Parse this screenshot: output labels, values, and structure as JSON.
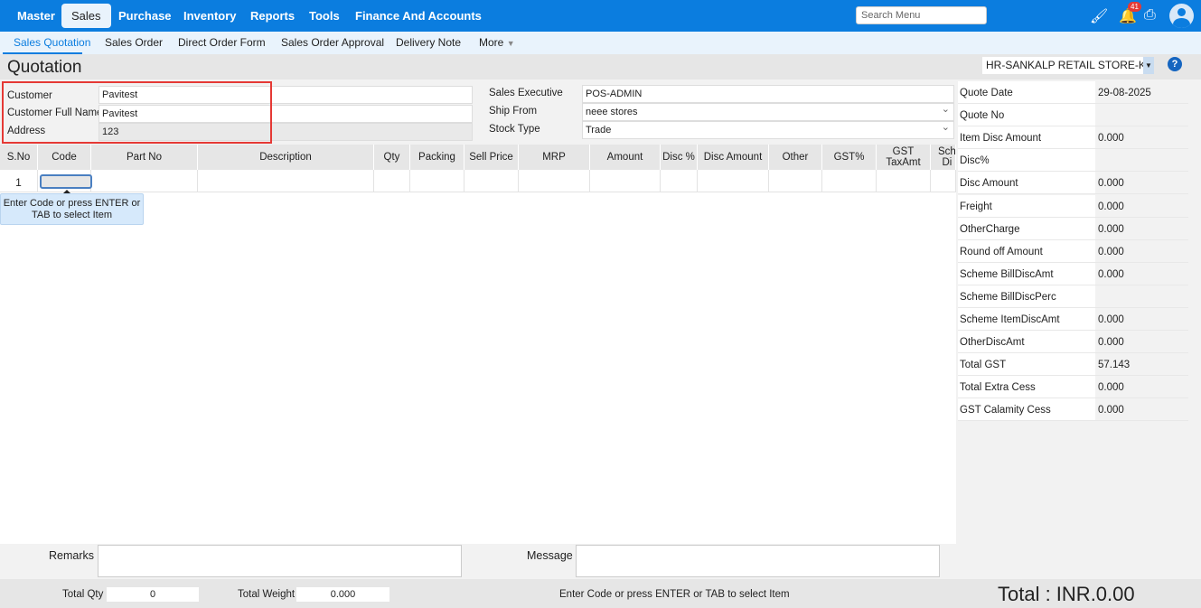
{
  "nav": {
    "items": [
      "Master",
      "Sales",
      "Purchase",
      "Inventory",
      "Reports",
      "Tools",
      "Finance And Accounts"
    ],
    "active": "Sales",
    "search_placeholder": "Search Menu",
    "notification_count": "41"
  },
  "subnav": {
    "items": [
      "Sales Quotation",
      "Sales Order",
      "Direct Order Form",
      "Sales Order Approval",
      "Delivery Note",
      "More"
    ],
    "active": "Sales Quotation"
  },
  "page": {
    "title": "Quotation",
    "store": "HR-SANKALP RETAIL STORE-K"
  },
  "customer": {
    "customer_label": "Customer",
    "customer_value": "Pavitest",
    "fullname_label": "Customer Full Name",
    "fullname_value": "Pavitest",
    "address_label": "Address",
    "address_value": "123"
  },
  "sales": {
    "exec_label": "Sales Executive",
    "exec_value": "POS-ADMIN",
    "shipfrom_label": "Ship From",
    "shipfrom_value": "neee stores",
    "stocktype_label": "Stock Type",
    "stocktype_value": "Trade"
  },
  "grid": {
    "columns": [
      "S.No",
      "Code",
      "Part No",
      "Description",
      "Qty",
      "Packing",
      "Sell Price",
      "MRP",
      "Amount",
      "Disc %",
      "Disc Amount",
      "Other",
      "GST%",
      "GST TaxAmt",
      "Sch Di"
    ],
    "rows": [
      {
        "sno": "1"
      }
    ],
    "tooltip": "Enter Code or press ENTER or TAB to select Item"
  },
  "summary": [
    {
      "k": "Quote Date",
      "v": "29-08-2025"
    },
    {
      "k": "Quote No",
      "v": ""
    },
    {
      "k": "Item Disc Amount",
      "v": "0.000"
    },
    {
      "k": "Disc%",
      "v": ""
    },
    {
      "k": "Disc Amount",
      "v": "0.000"
    },
    {
      "k": "Freight",
      "v": "0.000"
    },
    {
      "k": "OtherCharge",
      "v": "0.000"
    },
    {
      "k": "Round off Amount",
      "v": "0.000"
    },
    {
      "k": "Scheme BillDiscAmt",
      "v": "0.000"
    },
    {
      "k": "Scheme BillDiscPerc",
      "v": ""
    },
    {
      "k": "Scheme ItemDiscAmt",
      "v": "0.000"
    },
    {
      "k": "OtherDiscAmt",
      "v": "0.000"
    },
    {
      "k": "Total GST",
      "v": "57.143"
    },
    {
      "k": "Total Extra Cess",
      "v": "0.000"
    },
    {
      "k": "GST Calamity Cess",
      "v": "0.000"
    }
  ],
  "bottom": {
    "remarks_label": "Remarks",
    "message_label": "Message"
  },
  "footer": {
    "total_qty_label": "Total Qty",
    "total_qty": "0",
    "total_weight_label": "Total Weight",
    "total_weight": "0.000",
    "hint": "Enter Code or press ENTER or TAB to select Item",
    "total": "Total : INR.0.00"
  }
}
